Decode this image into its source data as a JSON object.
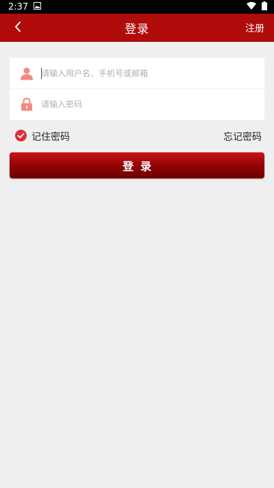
{
  "status_bar": {
    "time": "2:37",
    "icons": [
      "image-icon",
      "wifi-icon",
      "battery-icon"
    ]
  },
  "nav": {
    "title": "登录",
    "register_label": "注册",
    "back_icon": "chevron-left-icon",
    "bg_color": "#b00c0c"
  },
  "form": {
    "username_placeholder": "请输入用户名、手机号或邮箱",
    "password_placeholder": "请输入密码",
    "username_icon": "user-icon",
    "password_icon": "lock-icon",
    "icon_color": "#f08a82"
  },
  "options": {
    "remember_label": "记住密码",
    "remember_checked": true,
    "forgot_label": "忘记密码",
    "check_color": "#d9303a"
  },
  "login_button": {
    "label": "登录"
  }
}
